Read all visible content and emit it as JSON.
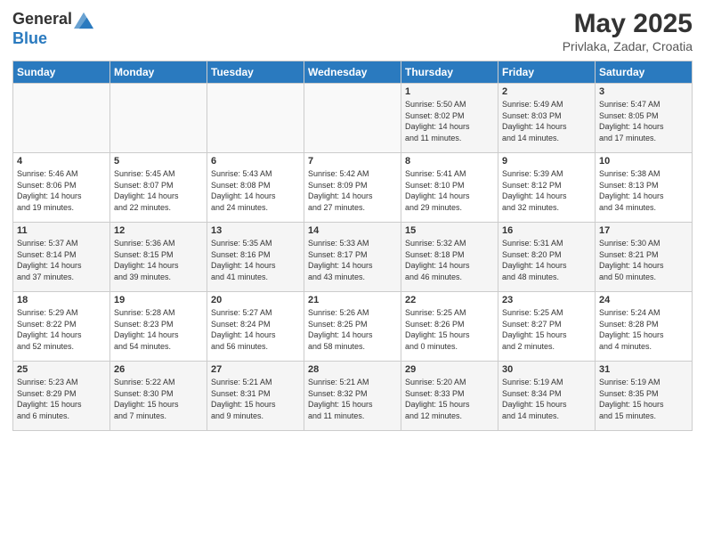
{
  "logo": {
    "general": "General",
    "blue": "Blue"
  },
  "header": {
    "title": "May 2025",
    "subtitle": "Privlaka, Zadar, Croatia"
  },
  "days_of_week": [
    "Sunday",
    "Monday",
    "Tuesday",
    "Wednesday",
    "Thursday",
    "Friday",
    "Saturday"
  ],
  "weeks": [
    [
      {
        "day": "",
        "info": ""
      },
      {
        "day": "",
        "info": ""
      },
      {
        "day": "",
        "info": ""
      },
      {
        "day": "",
        "info": ""
      },
      {
        "day": "1",
        "info": "Sunrise: 5:50 AM\nSunset: 8:02 PM\nDaylight: 14 hours\nand 11 minutes."
      },
      {
        "day": "2",
        "info": "Sunrise: 5:49 AM\nSunset: 8:03 PM\nDaylight: 14 hours\nand 14 minutes."
      },
      {
        "day": "3",
        "info": "Sunrise: 5:47 AM\nSunset: 8:05 PM\nDaylight: 14 hours\nand 17 minutes."
      }
    ],
    [
      {
        "day": "4",
        "info": "Sunrise: 5:46 AM\nSunset: 8:06 PM\nDaylight: 14 hours\nand 19 minutes."
      },
      {
        "day": "5",
        "info": "Sunrise: 5:45 AM\nSunset: 8:07 PM\nDaylight: 14 hours\nand 22 minutes."
      },
      {
        "day": "6",
        "info": "Sunrise: 5:43 AM\nSunset: 8:08 PM\nDaylight: 14 hours\nand 24 minutes."
      },
      {
        "day": "7",
        "info": "Sunrise: 5:42 AM\nSunset: 8:09 PM\nDaylight: 14 hours\nand 27 minutes."
      },
      {
        "day": "8",
        "info": "Sunrise: 5:41 AM\nSunset: 8:10 PM\nDaylight: 14 hours\nand 29 minutes."
      },
      {
        "day": "9",
        "info": "Sunrise: 5:39 AM\nSunset: 8:12 PM\nDaylight: 14 hours\nand 32 minutes."
      },
      {
        "day": "10",
        "info": "Sunrise: 5:38 AM\nSunset: 8:13 PM\nDaylight: 14 hours\nand 34 minutes."
      }
    ],
    [
      {
        "day": "11",
        "info": "Sunrise: 5:37 AM\nSunset: 8:14 PM\nDaylight: 14 hours\nand 37 minutes."
      },
      {
        "day": "12",
        "info": "Sunrise: 5:36 AM\nSunset: 8:15 PM\nDaylight: 14 hours\nand 39 minutes."
      },
      {
        "day": "13",
        "info": "Sunrise: 5:35 AM\nSunset: 8:16 PM\nDaylight: 14 hours\nand 41 minutes."
      },
      {
        "day": "14",
        "info": "Sunrise: 5:33 AM\nSunset: 8:17 PM\nDaylight: 14 hours\nand 43 minutes."
      },
      {
        "day": "15",
        "info": "Sunrise: 5:32 AM\nSunset: 8:18 PM\nDaylight: 14 hours\nand 46 minutes."
      },
      {
        "day": "16",
        "info": "Sunrise: 5:31 AM\nSunset: 8:20 PM\nDaylight: 14 hours\nand 48 minutes."
      },
      {
        "day": "17",
        "info": "Sunrise: 5:30 AM\nSunset: 8:21 PM\nDaylight: 14 hours\nand 50 minutes."
      }
    ],
    [
      {
        "day": "18",
        "info": "Sunrise: 5:29 AM\nSunset: 8:22 PM\nDaylight: 14 hours\nand 52 minutes."
      },
      {
        "day": "19",
        "info": "Sunrise: 5:28 AM\nSunset: 8:23 PM\nDaylight: 14 hours\nand 54 minutes."
      },
      {
        "day": "20",
        "info": "Sunrise: 5:27 AM\nSunset: 8:24 PM\nDaylight: 14 hours\nand 56 minutes."
      },
      {
        "day": "21",
        "info": "Sunrise: 5:26 AM\nSunset: 8:25 PM\nDaylight: 14 hours\nand 58 minutes."
      },
      {
        "day": "22",
        "info": "Sunrise: 5:25 AM\nSunset: 8:26 PM\nDaylight: 15 hours\nand 0 minutes."
      },
      {
        "day": "23",
        "info": "Sunrise: 5:25 AM\nSunset: 8:27 PM\nDaylight: 15 hours\nand 2 minutes."
      },
      {
        "day": "24",
        "info": "Sunrise: 5:24 AM\nSunset: 8:28 PM\nDaylight: 15 hours\nand 4 minutes."
      }
    ],
    [
      {
        "day": "25",
        "info": "Sunrise: 5:23 AM\nSunset: 8:29 PM\nDaylight: 15 hours\nand 6 minutes."
      },
      {
        "day": "26",
        "info": "Sunrise: 5:22 AM\nSunset: 8:30 PM\nDaylight: 15 hours\nand 7 minutes."
      },
      {
        "day": "27",
        "info": "Sunrise: 5:21 AM\nSunset: 8:31 PM\nDaylight: 15 hours\nand 9 minutes."
      },
      {
        "day": "28",
        "info": "Sunrise: 5:21 AM\nSunset: 8:32 PM\nDaylight: 15 hours\nand 11 minutes."
      },
      {
        "day": "29",
        "info": "Sunrise: 5:20 AM\nSunset: 8:33 PM\nDaylight: 15 hours\nand 12 minutes."
      },
      {
        "day": "30",
        "info": "Sunrise: 5:19 AM\nSunset: 8:34 PM\nDaylight: 15 hours\nand 14 minutes."
      },
      {
        "day": "31",
        "info": "Sunrise: 5:19 AM\nSunset: 8:35 PM\nDaylight: 15 hours\nand 15 minutes."
      }
    ]
  ]
}
